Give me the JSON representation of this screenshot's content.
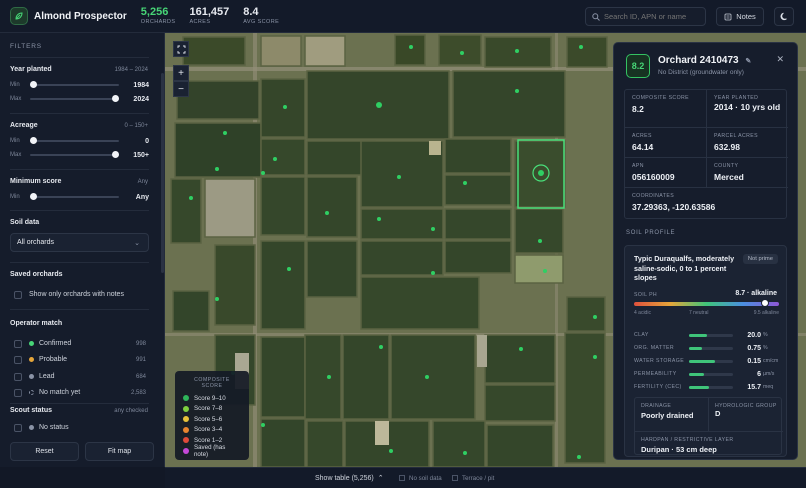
{
  "app": {
    "title": "Almond Prospector"
  },
  "stats": [
    {
      "value": "5,256",
      "label": "ORCHARDS",
      "color": "#47d577"
    },
    {
      "value": "161,457",
      "label": "ACRES",
      "color": "#eef1f6"
    },
    {
      "value": "8.4",
      "label": "AVG SCORE",
      "color": "#eef1f6"
    }
  ],
  "search": {
    "placeholder": "Search ID, APN or name"
  },
  "header": {
    "notes_label": "Notes"
  },
  "filters": {
    "heading": "FILTERS",
    "year_planted": {
      "title": "Year planted",
      "range": "1984 – 2024",
      "min_label": "Min",
      "min_value": "1984",
      "max_label": "Max",
      "max_value": "2024",
      "min_fraction": 0,
      "max_fraction": 1
    },
    "acreage": {
      "title": "Acreage",
      "range": "0 – 150+",
      "min_label": "Min",
      "min_value": "0",
      "max_label": "Max",
      "max_value": "150+",
      "min_fraction": 0,
      "max_fraction": 1
    },
    "min_score": {
      "title": "Minimum score",
      "range": "Any",
      "min_label": "Min",
      "value": "Any",
      "fraction": 0
    },
    "soil_data": {
      "title": "Soil data",
      "selected": "All orchards"
    },
    "saved": {
      "title": "Saved orchards",
      "checkbox_label": "Show only orchards with notes"
    },
    "operator_match": {
      "title": "Operator match",
      "items": [
        {
          "label": "Confirmed",
          "count": "998",
          "color": "#47d577"
        },
        {
          "label": "Probable",
          "count": "991",
          "color": "#e6a63a"
        },
        {
          "label": "Lead",
          "count": "684",
          "color": "#8a93a6"
        },
        {
          "label": "No match yet",
          "count": "2,583",
          "color": "dashed"
        }
      ]
    },
    "scout_status": {
      "title": "Scout status",
      "range": "any checked",
      "items": [
        {
          "label": "No status"
        }
      ]
    },
    "reset_label": "Reset",
    "fit_label": "Fit map"
  },
  "legend": {
    "title": "COMPOSITE SCORE",
    "items": [
      {
        "label": "Score 9–10",
        "color": "#2fb55a"
      },
      {
        "label": "Score 7–8",
        "color": "#7fcf3f"
      },
      {
        "label": "Score 5–6",
        "color": "#e7c23a"
      },
      {
        "label": "Score 3–4",
        "color": "#e8842f"
      },
      {
        "label": "Score 1–2",
        "color": "#df4a3a"
      },
      {
        "label": "Saved (has note)",
        "color": "#c548d8"
      }
    ]
  },
  "panel": {
    "score": "8.2",
    "title": "Orchard 2410473",
    "subtitle": "No District (groundwater only)",
    "fields": {
      "composite_score": {
        "label": "COMPOSITE SCORE",
        "value": "8.2"
      },
      "year_planted": {
        "label": "YEAR PLANTED",
        "value": "2014 · 10 yrs old"
      },
      "acres": {
        "label": "ACRES",
        "value": "64.14"
      },
      "parcel_acres": {
        "label": "PARCEL ACRES",
        "value": "632.98"
      },
      "apn": {
        "label": "APN",
        "value": "056160009"
      },
      "county": {
        "label": "COUNTY",
        "value": "Merced"
      },
      "coordinates": {
        "label": "COORDINATES",
        "value": "37.29363, -120.63586"
      }
    },
    "soil_heading": "SOIL PROFILE",
    "soil": {
      "name": "Typic Duraqualfs, moderately saline-sodic, 0 to 1 percent slopes",
      "badge": "Not prime",
      "ph_label": "SOIL PH",
      "ph_value": "8.7 · alkaline",
      "ph_fraction": 0.9,
      "ph_ticks": [
        "4 acidic",
        "7 neutral",
        "9.5 alkaline"
      ],
      "metrics": [
        {
          "label": "CLAY",
          "value": "20.0",
          "unit": "%",
          "fraction": 0.42
        },
        {
          "label": "ORG. MATTER",
          "value": "0.75",
          "unit": "%",
          "fraction": 0.3
        },
        {
          "label": "WATER STORAGE",
          "value": "0.15",
          "unit": "cm/cm",
          "fraction": 0.6
        },
        {
          "label": "PERMEABILITY",
          "value": "6",
          "unit": "µm/s",
          "fraction": 0.35
        },
        {
          "label": "FERTILITY (CEC)",
          "value": "15.7",
          "unit": "meq",
          "fraction": 0.45
        }
      ],
      "drainage": {
        "label": "DRAINAGE",
        "value": "Poorly drained"
      },
      "hydrologic": {
        "label": "HYDROLOGIC GROUP",
        "value": "D"
      },
      "hardpan": {
        "label": "HARDPAN / RESTRICTIVE LAYER",
        "value": "Duripan · 53 cm deep"
      }
    }
  },
  "bottom": {
    "show_table": "Show table (5,256)",
    "no_soil": "No soil data",
    "terrace": "Terrace / pit"
  }
}
